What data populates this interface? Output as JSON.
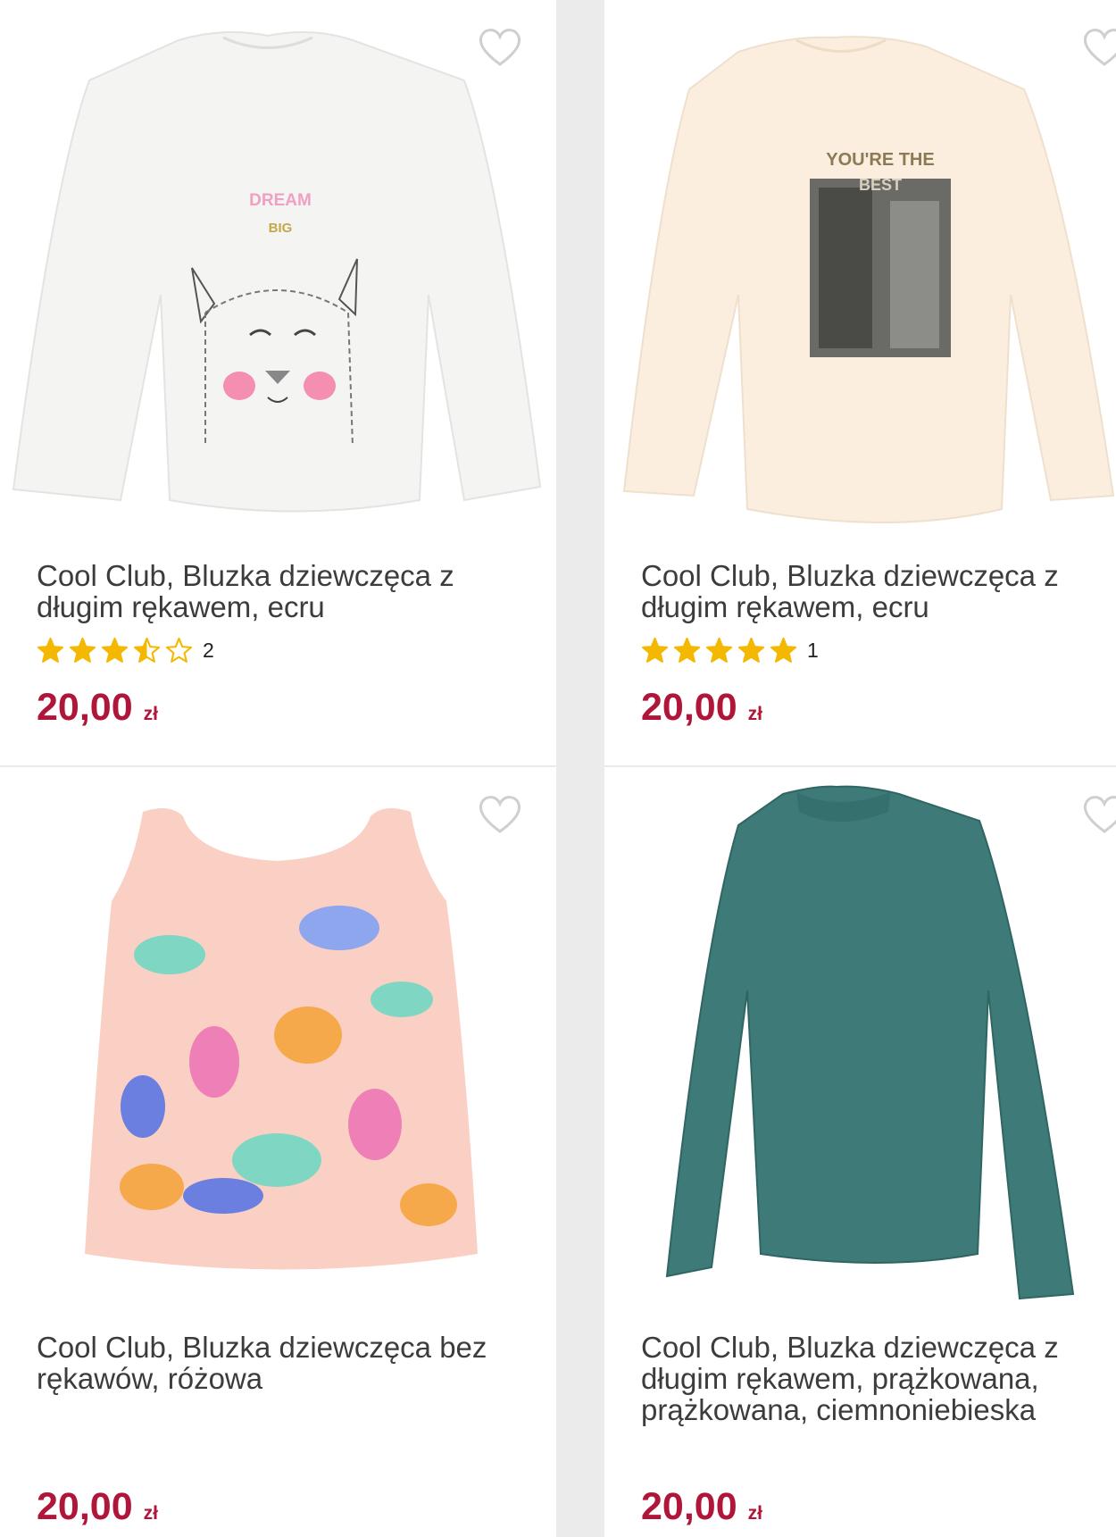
{
  "products": [
    {
      "title": "Cool Club, Bluzka dziewczęca z długim rękawem, ecru",
      "rating_value": 3.5,
      "rating_count": "2",
      "price": "20,00",
      "currency": "zł",
      "garment_color": "#f4f5f3",
      "print_text": [
        "DREAM",
        "BIG"
      ]
    },
    {
      "title": "Cool Club, Bluzka dziewczęca z długim rękawem, ecru",
      "rating_value": 5,
      "rating_count": "1",
      "price": "20,00",
      "currency": "zł",
      "garment_color": "#fbeedf",
      "print_text": [
        "YOU'RE THE",
        "BEST"
      ]
    },
    {
      "title": "Cool Club, Bluzka dziewczęca bez rękawów, różowa",
      "price": "20,00",
      "currency": "zł",
      "garment_color": "#fbd0c4"
    },
    {
      "title": "Cool Club, Bluzka dziewczęca z długim rękawem, prążkowana, prążkowana, ciemnoniebieska",
      "price": "20,00",
      "currency": "zł",
      "garment_color": "#3d7a78"
    }
  ],
  "colors": {
    "price": "#b0163a",
    "star": "#f5b800",
    "heart": "#cfcfcf"
  },
  "icons": {
    "favorite": "heart-outline-icon",
    "rating": "star-icon"
  }
}
